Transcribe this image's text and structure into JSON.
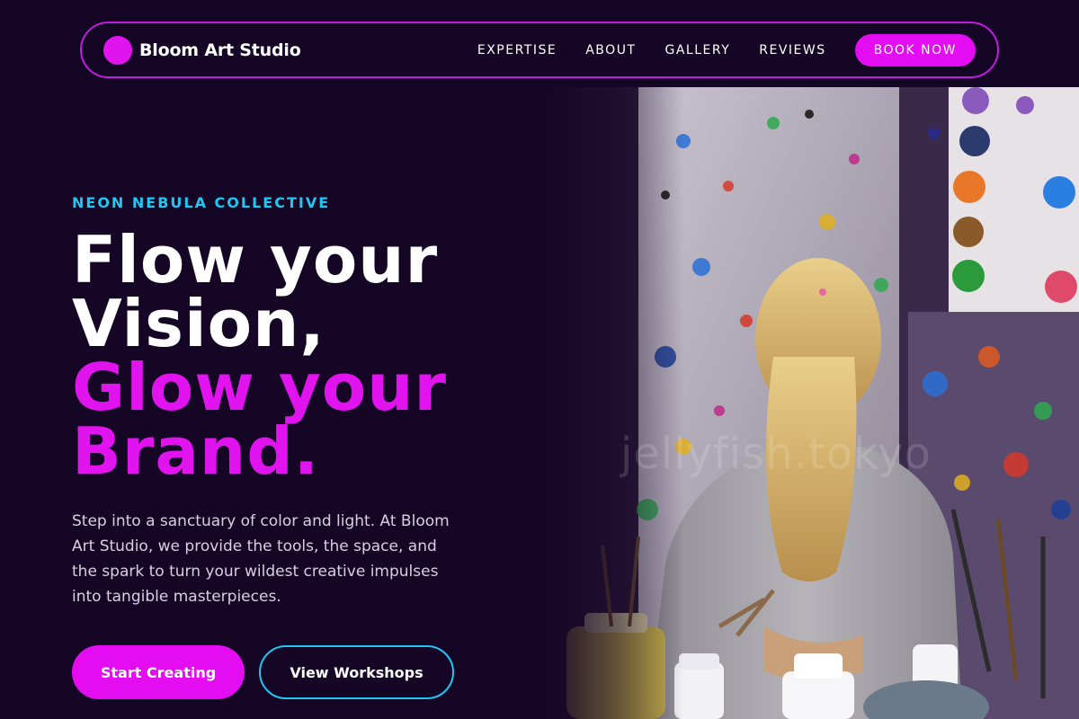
{
  "nav": {
    "brand": "Bloom Art Studio",
    "links": [
      "EXPERTISE",
      "ABOUT",
      "GALLERY",
      "REVIEWS"
    ],
    "cta": "BOOK NOW"
  },
  "hero": {
    "eyebrow": "NEON NEBULA COLLECTIVE",
    "headline_line1": "Flow your",
    "headline_line2": "Vision,",
    "headline_line3": "Glow your",
    "headline_line4": "Brand.",
    "description": "Step into a sanctuary of color and light. At Bloom Art Studio, we provide the tools, the space, and the spark to turn your wildest creative impulses into tangible masterpieces.",
    "primary_button": "Start Creating",
    "secondary_button": "View Workshops",
    "image_watermark": "jellyfish.tokyo"
  },
  "colors": {
    "background": "#150626",
    "accent_pink": "#e40df2",
    "accent_cyan": "#1ec8f3"
  },
  "icons": {
    "logo": "logo-dot-icon"
  }
}
